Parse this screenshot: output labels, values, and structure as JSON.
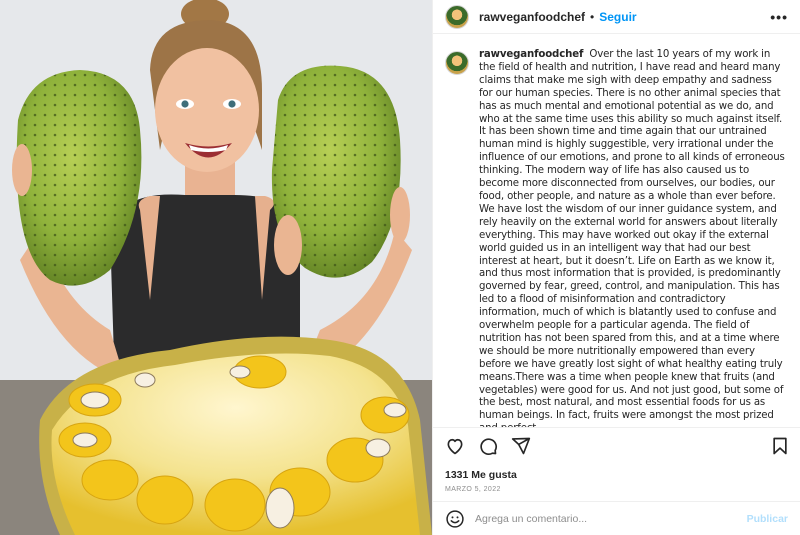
{
  "post": {
    "username": "rawveganfoodchef",
    "separator": "•",
    "follow_label": "Seguir",
    "more_label": "•••",
    "caption_text": "Over the last 10 years of my work in the field of health and nutrition, I have read and heard many claims that make me sigh with deep empathy and sadness for our human species. There is no other animal species that has as much mental and emotional potential as we do, and who at the same time uses this ability so much against itself. It has been shown time and time again that our untrained human mind is highly suggestible, very irrational under the influence of our emotions, and prone to all kinds of erroneous thinking. The modern way of life has also caused us to become more disconnected from ourselves, our bodies, our food, other people, and nature as a whole than ever before. We have lost the wisdom of our inner guidance system, and rely heavily on the external world for answers about literally everything. This may have worked out okay if the external world guided us in an intelligent way that had our best interest at heart, but it doesn’t. Life on Earth as we know it, and thus most information that is provided, is predominantly governed by fear, greed, control, and manipulation. This has led to a flood of misinformation and contradictory information, much of which is blatantly used to confuse and overwhelm people for a particular agenda. The field of nutrition has not been spared from this, and at a time where we should be more nutritionally empowered than every before we have greatly lost sight of what healthy eating truly means.There was a time when people knew that fruits (and vegetables) were good for us. And not just good, but some of the best, most natural, and most essential foods for us as human beings. In fact, fruits were amongst the most prized and perfect",
    "likes_text": "1331 Me gusta",
    "date_text": "MARZO 5, 2022",
    "comment_placeholder": "Agrega un comentario...",
    "publish_label": "Publicar"
  },
  "icons": {
    "like": "heart-icon",
    "comment": "comment-icon",
    "share": "send-icon",
    "save": "bookmark-icon",
    "emoji": "emoji-icon",
    "more": "more-icon"
  },
  "colors": {
    "accent": "#0095f6",
    "publish_disabled": "#b2dffc",
    "muted": "#8e8e8e",
    "text": "#262626"
  }
}
